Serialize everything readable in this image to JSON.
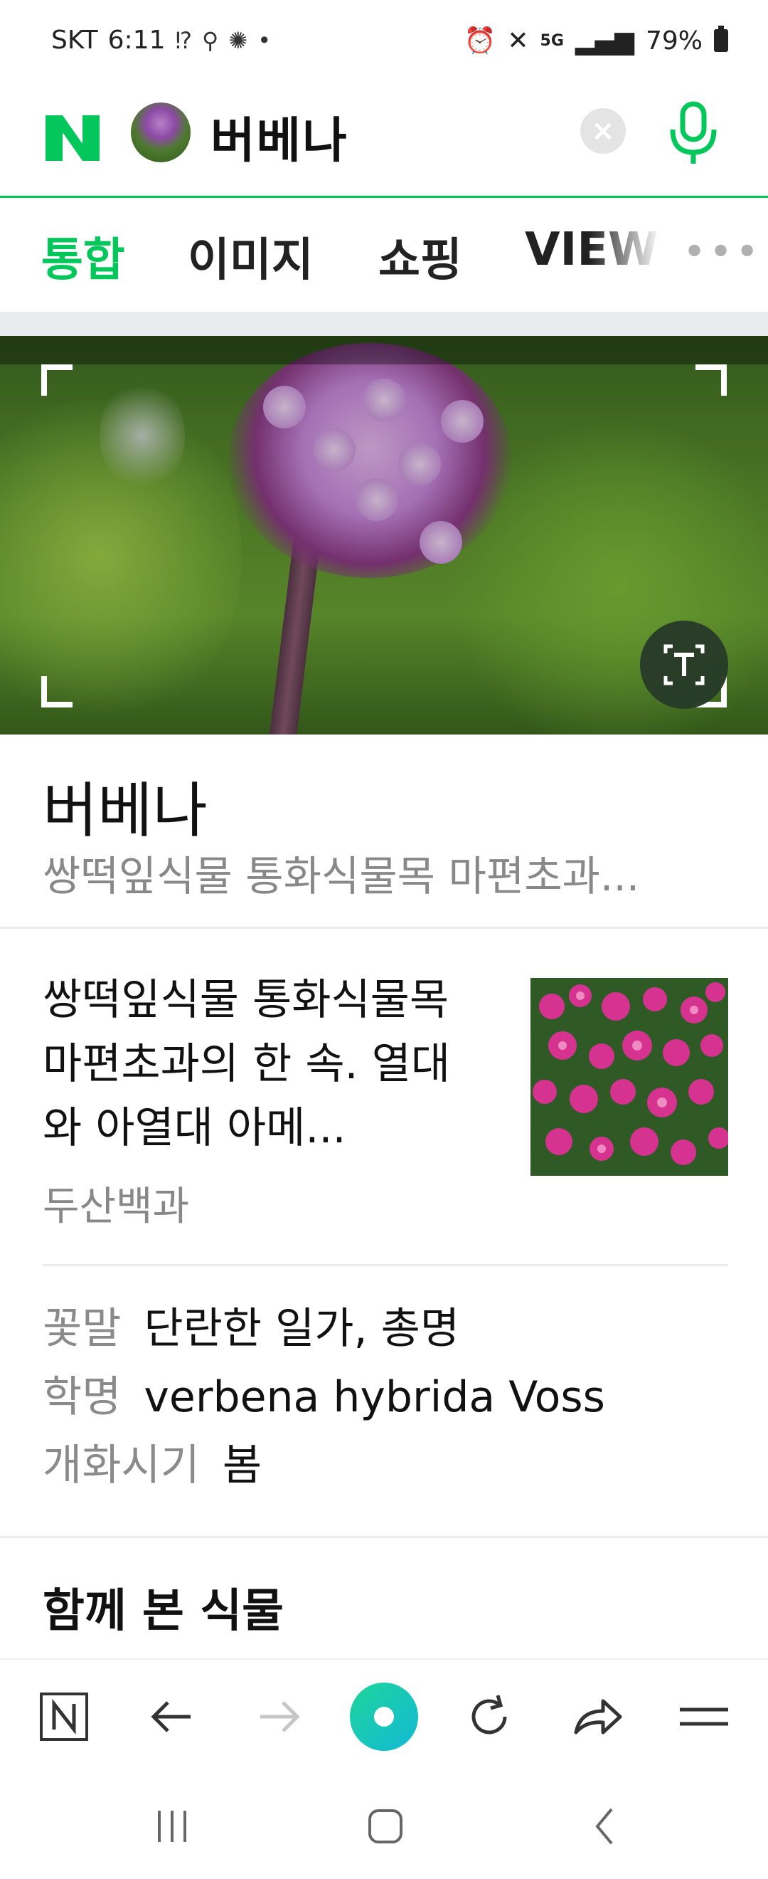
{
  "status_bar": {
    "carrier": "SKT",
    "time": "6:11",
    "battery": "79%",
    "network": "5G",
    "icons_left": [
      "voicemail-icon",
      "search-icon",
      "run-icon",
      "dot-icon"
    ],
    "icons_right": [
      "alarm-icon",
      "mute-icon",
      "network-5g-icon",
      "signal-icon",
      "battery-icon"
    ]
  },
  "search": {
    "logo": "N",
    "query": "버베나",
    "accent_color": "#03c75a"
  },
  "tabs": [
    {
      "label": "통합",
      "active": true
    },
    {
      "label": "이미지",
      "active": false
    },
    {
      "label": "쇼핑",
      "active": false
    },
    {
      "label": "VIEW",
      "active": false
    }
  ],
  "result": {
    "title": "버베나",
    "subtitle": "쌍떡잎식물 통화식물목 마편초과...",
    "description": "쌍떡잎식물 통화식물목 마편초과의 한 속. 열대와 아열대 아메...",
    "source": "두산백과",
    "info": [
      {
        "label": "꽃말",
        "value": "단란한 일가, 총명"
      },
      {
        "label": "학명",
        "value": "verbena hybrida Voss"
      },
      {
        "label": "개화시기",
        "value": "봄"
      }
    ]
  },
  "section": {
    "title": "함께 본 식물"
  },
  "toolbar": {
    "items": [
      "naver-home-icon",
      "back-arrow-icon",
      "forward-arrow-icon",
      "green-dot-icon",
      "refresh-icon",
      "share-icon",
      "menu-icon"
    ]
  }
}
